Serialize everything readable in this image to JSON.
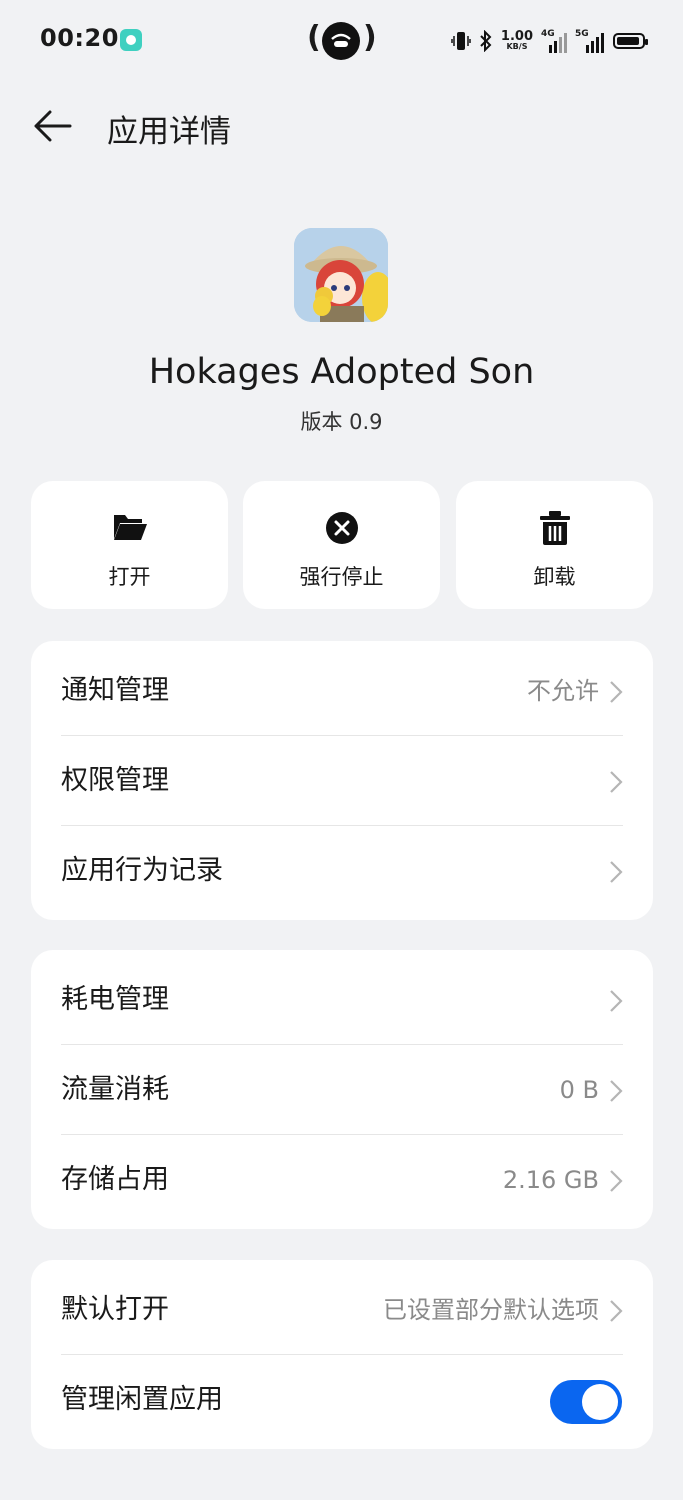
{
  "status_bar": {
    "time": "00:20",
    "net_speed": "1.00",
    "net_unit": "KB/S",
    "net_4g": "4G",
    "net_5g": "5G"
  },
  "header": {
    "title": "应用详情"
  },
  "app": {
    "name": "Hokages Adopted Son",
    "version": "版本 0.9"
  },
  "actions": [
    {
      "label": "打开",
      "icon": "folder-open-icon"
    },
    {
      "label": "强行停止",
      "icon": "close-circle-icon"
    },
    {
      "label": "卸载",
      "icon": "trash-icon"
    }
  ],
  "group1": [
    {
      "label": "通知管理",
      "value": "不允许"
    },
    {
      "label": "权限管理",
      "value": ""
    },
    {
      "label": "应用行为记录",
      "value": ""
    }
  ],
  "group2": [
    {
      "label": "耗电管理",
      "value": ""
    },
    {
      "label": "流量消耗",
      "value": "0 B"
    },
    {
      "label": "存储占用",
      "value": "2.16 GB"
    }
  ],
  "group3": [
    {
      "label": "默认打开",
      "value": "已设置部分默认选项"
    },
    {
      "label": "管理闲置应用",
      "toggle_on": true
    }
  ],
  "colors": {
    "accent": "#0a66f0",
    "background": "#f1f2f4",
    "card": "#ffffff"
  }
}
